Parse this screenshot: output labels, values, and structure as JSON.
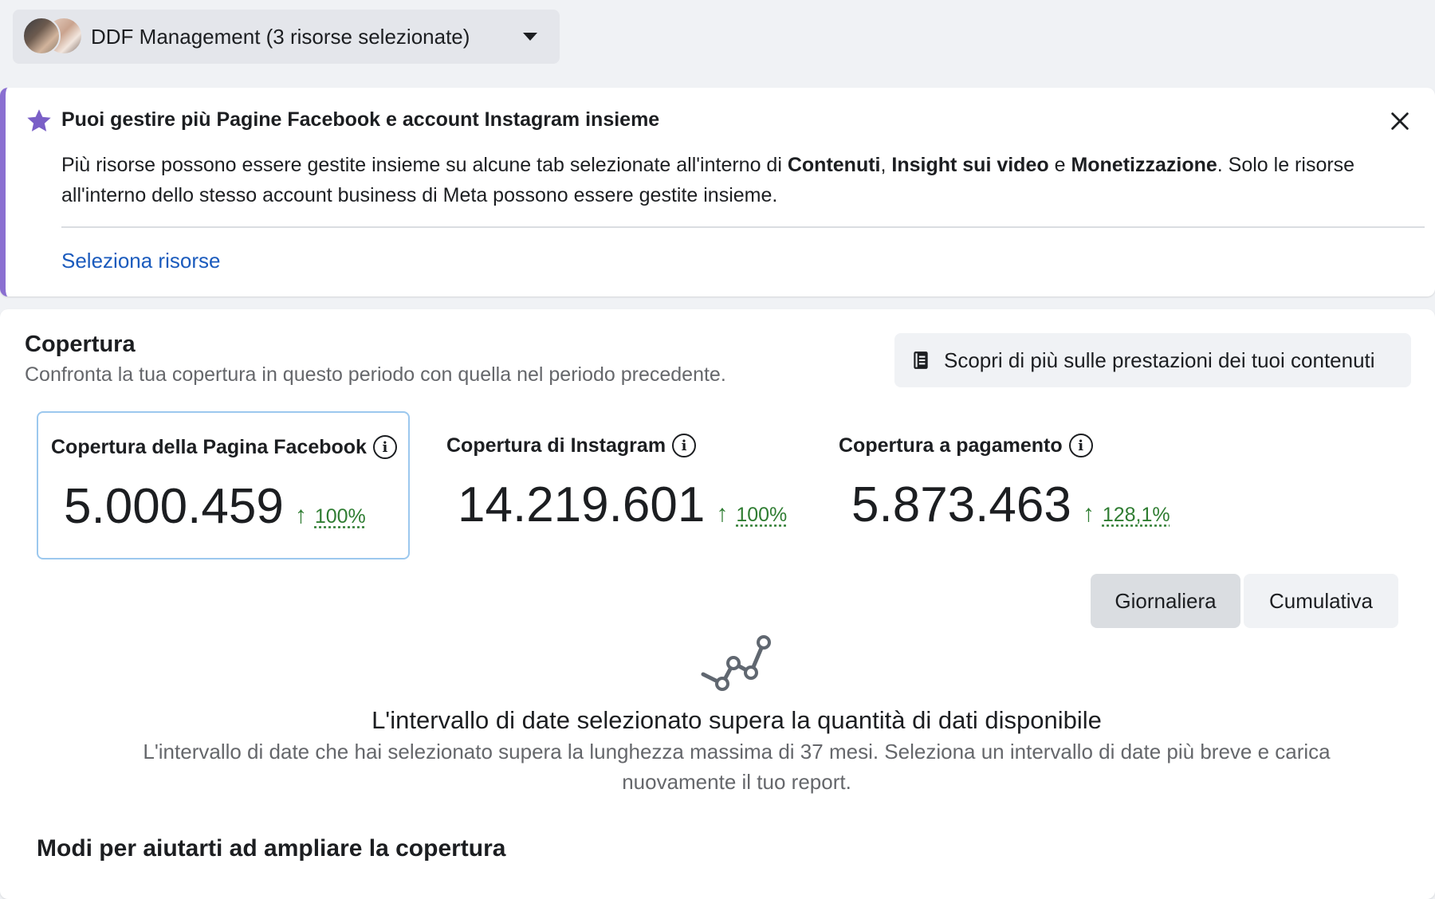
{
  "account_selector": {
    "label": "DDF Management (3 risorse selezionate)",
    "icon": "chevron-down-icon"
  },
  "banner": {
    "icon": "star-icon",
    "accent_color": "#8a6fd1",
    "title": "Puoi gestire più Pagine Facebook e account Instagram insieme",
    "body_parts": [
      "Più risorse possono essere gestite insieme su alcune tab selezionate all'interno di ",
      "Contenuti",
      ", ",
      "Insight sui video",
      " e ",
      "Monetizzazione",
      ". Solo le risorse all'interno dello stesso account business di Meta possono essere gestite insieme."
    ],
    "link": "Seleziona risorse",
    "link_color": "#1b5bbd",
    "close_icon": "close-icon"
  },
  "reach": {
    "title": "Copertura",
    "subtitle": "Confronta la tua copertura in questo periodo con quella nel periodo precedente.",
    "learn_button": "Scopri di più sulle prestazioni dei tuoi contenuti",
    "metrics": [
      {
        "label": "Copertura della Pagina Facebook",
        "value": "5.000.459",
        "change": "100%",
        "selected": true
      },
      {
        "label": "Copertura di Instagram",
        "value": "14.219.601",
        "change": "100%",
        "selected": false
      },
      {
        "label": "Copertura a pagamento",
        "value": "5.873.463",
        "change": "128,1%",
        "selected": false
      }
    ],
    "trend_color": "#2f7d32",
    "toggle": {
      "daily": "Giornaliera",
      "cumulative": "Cumulativa",
      "selected": "Giornaliera"
    },
    "empty_state": {
      "icon": "line-chart-icon",
      "title": "L'intervallo di date selezionato supera la quantità di dati disponibile",
      "description": "L'intervallo di date che hai selezionato supera la lunghezza massima di 37 mesi. Seleziona un intervallo di date più breve e carica nuovamente il tuo report."
    },
    "tips_title": "Modi per aiutarti ad ampliare la copertura"
  }
}
